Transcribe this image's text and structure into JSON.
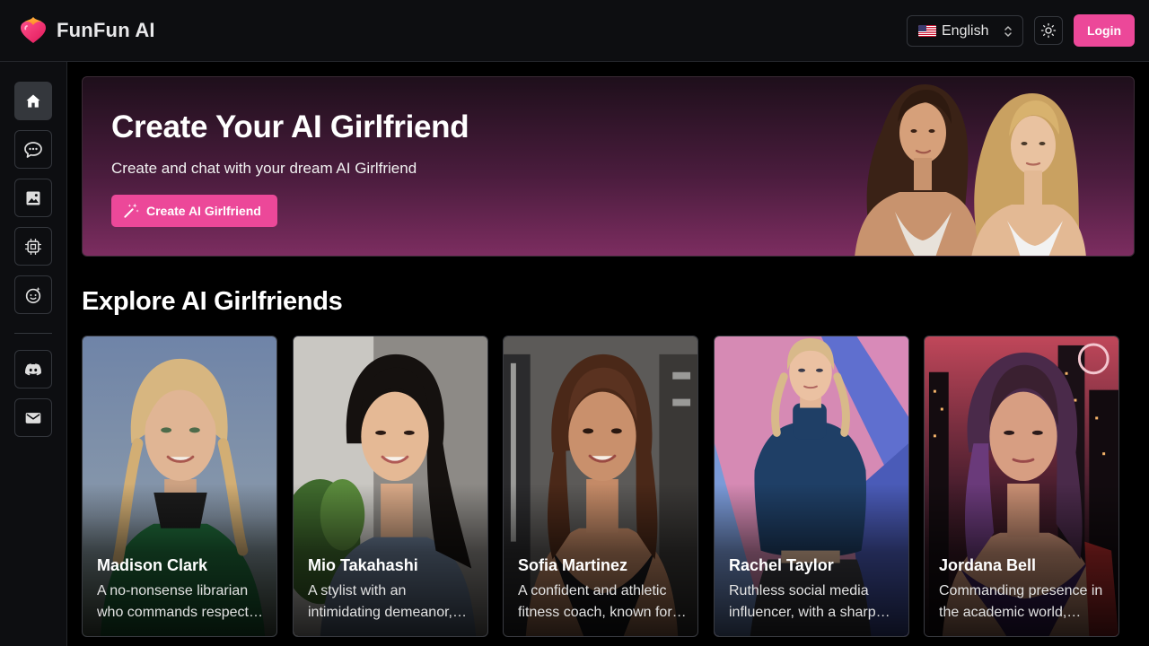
{
  "header": {
    "brand": "FunFun AI",
    "language": "English",
    "login_label": "Login"
  },
  "sidebar": {
    "items": [
      {
        "name": "home",
        "icon": "home-icon",
        "active": true
      },
      {
        "name": "chat",
        "icon": "chat-bubble-icon"
      },
      {
        "name": "gallery",
        "icon": "image-icon"
      },
      {
        "name": "generate",
        "icon": "cpu-chip-icon"
      },
      {
        "name": "create-character",
        "icon": "face-sparkle-icon"
      },
      {
        "name": "discord",
        "icon": "discord-icon"
      },
      {
        "name": "contact",
        "icon": "mail-icon"
      }
    ]
  },
  "banner": {
    "title": "Create Your AI Girlfriend",
    "subtitle": "Create and chat with your dream AI Girlfriend",
    "cta_label": "Create AI Girlfriend"
  },
  "explore": {
    "title": "Explore AI Girlfriends",
    "cards": [
      {
        "name": "Madison Clark",
        "description": "A no-nonsense librarian who commands respect with her sharp wit."
      },
      {
        "name": "Mio Takahashi",
        "description": "A stylist with an intimidating demeanor, known for her bold looks."
      },
      {
        "name": "Sofia Martinez",
        "description": "A confident and athletic fitness coach, known for her energy."
      },
      {
        "name": "Rachel Taylor",
        "description": "Ruthless social media influencer, with a sharp tongue."
      },
      {
        "name": "Jordana Bell",
        "description": "Commanding presence in the academic world, admired by many."
      }
    ]
  },
  "colors": {
    "accent": "#ec4899",
    "background": "#000000",
    "panel": "#0d0e11"
  }
}
